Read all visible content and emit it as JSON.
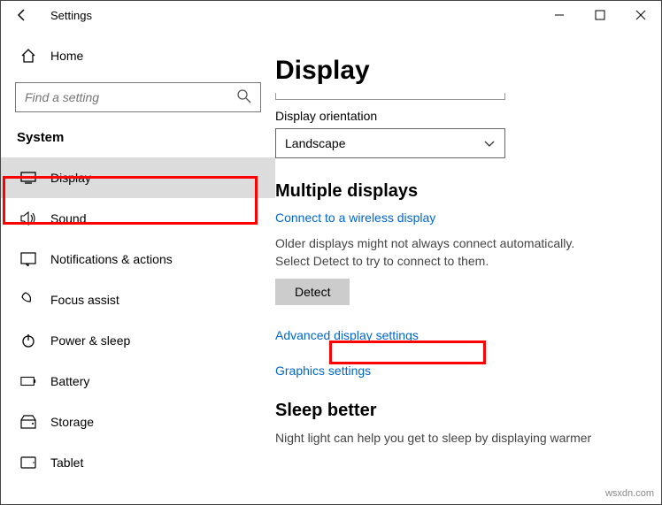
{
  "titlebar": {
    "title": "Settings"
  },
  "search": {
    "placeholder": "Find a setting"
  },
  "sidebar": {
    "home_label": "Home",
    "section_label": "System",
    "items": [
      {
        "label": "Display"
      },
      {
        "label": "Sound"
      },
      {
        "label": "Notifications & actions"
      },
      {
        "label": "Focus assist"
      },
      {
        "label": "Power & sleep"
      },
      {
        "label": "Battery"
      },
      {
        "label": "Storage"
      },
      {
        "label": "Tablet"
      }
    ]
  },
  "content": {
    "page_title": "Display",
    "orientation_label": "Display orientation",
    "orientation_value": "Landscape",
    "multi_heading": "Multiple displays",
    "wireless_link": "Connect to a wireless display",
    "older_text": "Older displays might not always connect automatically. Select Detect to try to connect to them.",
    "detect_button": "Detect",
    "advanced_link": "Advanced display settings",
    "graphics_link": "Graphics settings",
    "sleep_heading": "Sleep better",
    "sleep_text": "Night light can help you get to sleep by displaying warmer"
  },
  "watermark": "wsxdn.com"
}
